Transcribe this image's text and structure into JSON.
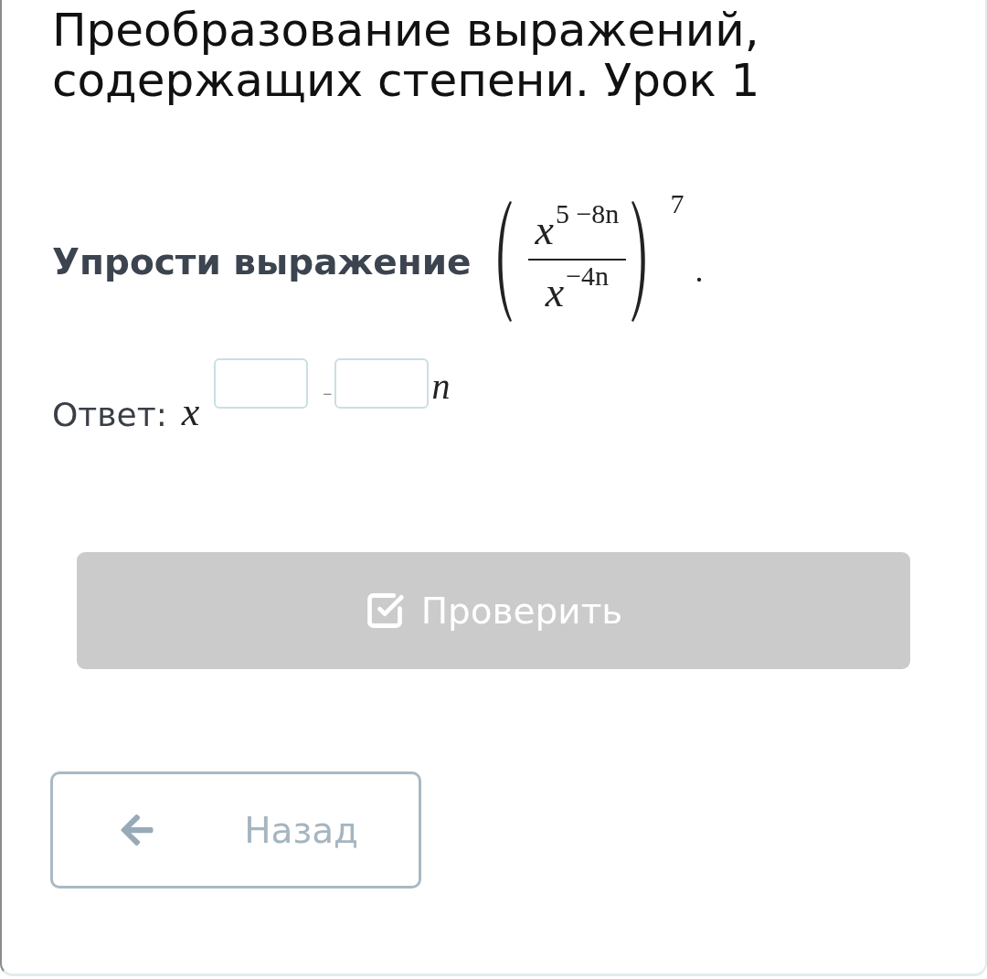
{
  "lesson": {
    "title": "Преобразование выражений, содержащих степени. Урок 1"
  },
  "task": {
    "prompt": "Упрости выражение",
    "expression": {
      "numerator": {
        "base": "x",
        "exponent": "5 −8n"
      },
      "denominator": {
        "base": "x",
        "exponent": "−4n"
      },
      "power": "7",
      "end": "."
    }
  },
  "answer": {
    "label": "Ответ:",
    "base": "x",
    "exponent": [
      {
        "kind": "field"
      },
      {
        "kind": "text",
        "text": "−"
      },
      {
        "kind": "field"
      },
      {
        "kind": "text",
        "text": "n"
      }
    ]
  },
  "check_button": {
    "label": "Проверить",
    "disabled": true
  },
  "back_button": {
    "label": "Назад"
  }
}
